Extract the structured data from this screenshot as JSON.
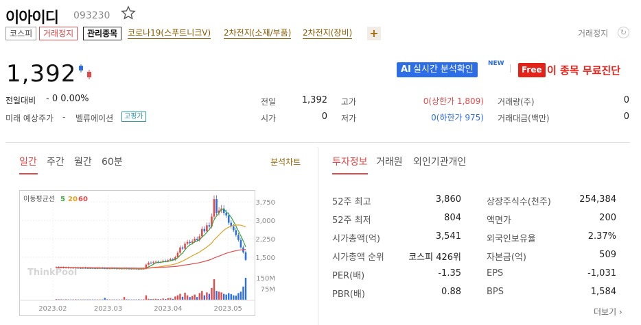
{
  "header": {
    "name": "이아이디",
    "code": "093230",
    "tags": [
      "코스피",
      "거래정지",
      "관리종목"
    ],
    "themes": [
      "코로나19(스푸트니크V)",
      "2차전지(소재/부품)",
      "2차전지(장비)"
    ],
    "plus": "+",
    "status_right": "거래정지"
  },
  "price": {
    "current": "1,392",
    "change_label": "전일대비",
    "change_value": "- 0 0.00%",
    "future_label": "미래 예상주가",
    "future_value": "-",
    "valuation_label": "벨류에이션",
    "valuation_badge": "고평가"
  },
  "promo": {
    "ai_prefix": "AI",
    "ai_label": "실시간 분석확인",
    "new_badge": "NEW",
    "free_badge": "Free",
    "diagnosis_label": "이 종목 무료진단"
  },
  "quote": {
    "prev_close_label": "전일",
    "prev_close": "1,392",
    "open_label": "시가",
    "open": "0",
    "high_label": "고가",
    "high": "0(상한가 1,809)",
    "low_label": "저가",
    "low": "0(하한가 975)",
    "volume_label": "거래량(주)",
    "volume": "0",
    "amount_label": "거래대금(백만)",
    "amount": "0"
  },
  "chart_tabs": [
    "일간",
    "주간",
    "월간",
    "60분"
  ],
  "analysis_link": "분석차트",
  "info_tabs": [
    "투자정보",
    "거래원",
    "외인기관개인"
  ],
  "chart_data": {
    "type": "candlestick",
    "legend_title": "이동평균선",
    "ma_labels": [
      "5",
      "20",
      "60"
    ],
    "ma_colors": [
      "#3aa13a",
      "#e0a020",
      "#e04a4a"
    ],
    "price_ticks": [
      "3,750",
      "3,000",
      "2,250",
      "1,500"
    ],
    "volume_ticks": [
      "150M",
      "75M"
    ],
    "x_ticks": [
      "2023.02",
      "2023.03",
      "2023.04",
      "2023.05"
    ],
    "watermark": "ThinkPool",
    "ylim": [
      750,
      4000
    ],
    "closes": [
      1090,
      1080,
      1085,
      1075,
      1080,
      1070,
      1075,
      1068,
      1072,
      1065,
      1060,
      1068,
      1062,
      1058,
      1060,
      1055,
      1050,
      1058,
      1062,
      1055,
      1050,
      1046,
      1048,
      1052,
      1045,
      1040,
      1042,
      1038,
      1045,
      1040,
      1035,
      1030,
      1038,
      1025,
      1020,
      1030,
      1035,
      1200,
      1280,
      1260,
      1300,
      1320,
      1290,
      1310,
      1350,
      1340,
      1380,
      1420,
      1400,
      1500,
      1680,
      1900,
      1850,
      2050,
      2120,
      2080,
      2150,
      2250,
      2200,
      2350,
      2650,
      2550,
      2800,
      2750,
      3150,
      3860,
      3300,
      3400,
      3480,
      3300,
      3200,
      2900,
      2750,
      2600,
      2400,
      2200,
      1900,
      1700,
      1392
    ],
    "volumes": [
      4,
      3,
      3,
      2,
      3,
      2,
      2,
      2,
      3,
      2,
      2,
      2,
      2,
      2,
      2,
      2,
      2,
      2,
      2,
      2,
      12,
      3,
      2,
      2,
      2,
      2,
      2,
      2,
      18,
      3,
      2,
      2,
      2,
      2,
      3,
      2,
      3,
      30,
      6,
      4,
      5,
      6,
      4,
      4,
      8,
      5,
      10,
      12,
      6,
      22,
      30,
      40,
      20,
      48,
      30,
      18,
      25,
      35,
      18,
      45,
      60,
      30,
      50,
      40,
      80,
      140,
      60,
      55,
      50,
      40,
      35,
      45,
      38,
      30,
      28,
      45,
      55,
      90,
      150
    ]
  },
  "investment": {
    "left": [
      {
        "label": "52주 최고",
        "value": "3,860"
      },
      {
        "label": "52주 최저",
        "value": "804"
      },
      {
        "label": "시가총액(억)",
        "value": "3,541"
      },
      {
        "label": "시가총액 순위",
        "value": "코스피 426위"
      },
      {
        "label": "PER(배)",
        "value": "-1.35"
      },
      {
        "label": "PBR(배)",
        "value": "0.88"
      }
    ],
    "right": [
      {
        "label": "상장주식수(천주)",
        "value": "254,384"
      },
      {
        "label": "액면가",
        "value": "200"
      },
      {
        "label": "외국인보유율",
        "value": "2.37%"
      },
      {
        "label": "자본금(억)",
        "value": "509"
      },
      {
        "label": "EPS",
        "value": "-1,031"
      },
      {
        "label": "BPS",
        "value": "1,584"
      }
    ],
    "more": "더보기 ›"
  }
}
